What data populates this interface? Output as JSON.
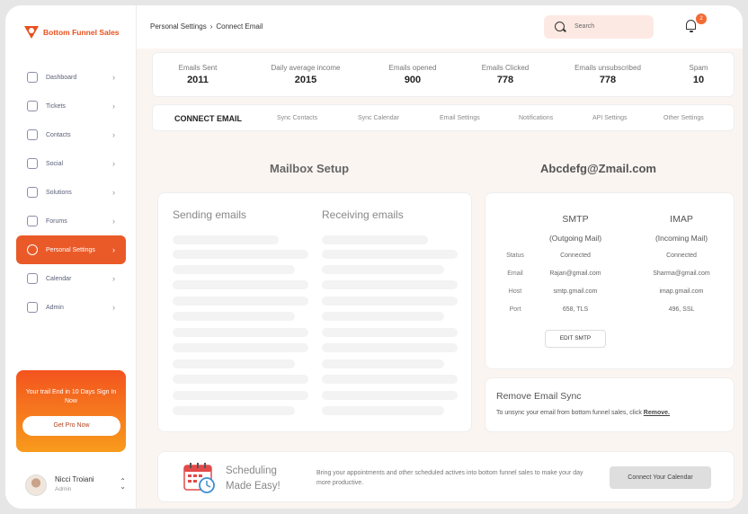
{
  "brand": {
    "name": "Bottom Funnel Sales",
    "accent": "#ea5a28"
  },
  "sidebar": {
    "items": [
      {
        "label": "Dashboard",
        "icon": "chart-icon"
      },
      {
        "label": "Tickets",
        "icon": "ticket-icon"
      },
      {
        "label": "Contacts",
        "icon": "contacts-icon"
      },
      {
        "label": "Social",
        "icon": "social-icon"
      },
      {
        "label": "Solutions",
        "icon": "solutions-icon"
      },
      {
        "label": "Forums",
        "icon": "forums-icon"
      },
      {
        "label": "Personal Settings",
        "icon": "settings-icon",
        "active": true
      },
      {
        "label": "Calendar",
        "icon": "calendar-icon"
      },
      {
        "label": "Admin",
        "icon": "admin-icon"
      }
    ],
    "promo": {
      "text": "Your trail End in 10 Days Sign In Now",
      "button": "Get Pro Now"
    },
    "user": {
      "name": "Nicci Troiani",
      "role": "Admin"
    }
  },
  "header": {
    "breadcrumb": [
      "Personal Settings",
      "Connect Email"
    ],
    "search_placeholder": "Search",
    "notifications": "2"
  },
  "stats": [
    {
      "label": "Emails Sent",
      "value": "2011"
    },
    {
      "label": "Daily average income",
      "value": "2015"
    },
    {
      "label": "Emails opened",
      "value": "900"
    },
    {
      "label": "Emails Clicked",
      "value": "778"
    },
    {
      "label": "Emails unsubscribed",
      "value": "778"
    },
    {
      "label": "Spam",
      "value": "10"
    }
  ],
  "tabs": [
    "CONNECT EMAIL",
    "Sync Contacts",
    "Sync Calendar",
    "Email Settings",
    "Notifications",
    "API Settings",
    "Other Settings"
  ],
  "mailbox": {
    "title": "Mailbox Setup",
    "sending": "Sending emails",
    "receiving": "Receiving emails"
  },
  "account": {
    "email": "Abcdefg@Zmail.com",
    "smtp": {
      "title": "SMTP",
      "sub": "(Outgoing Mail)",
      "status": "Connected",
      "email": "Rajan@gmail.com",
      "host": "smtp.gmail.com",
      "port": "658, TLS"
    },
    "imap": {
      "title": "IMAP",
      "sub": "(Incoming Mail)",
      "status": "Connected",
      "email": "Sharma@gmail.com",
      "host": "imap.gmail.com",
      "port": "496, SSL"
    },
    "labels": {
      "status": "Status",
      "email": "Email",
      "host": "Host",
      "port": "Port"
    },
    "edit_button": "EDIT SMTP"
  },
  "remove_sync": {
    "title": "Remove Email Sync",
    "desc": "To unsync your email from bottom funnel  sales, click ",
    "link": "Remove."
  },
  "banner": {
    "title_line1": "Scheduling",
    "title_line2": "Made Easy!",
    "desc": "Bring your appointments and other scheduled actives into bottom funnel sales to make your day more productive.",
    "button": "Connect Your Calendar"
  }
}
